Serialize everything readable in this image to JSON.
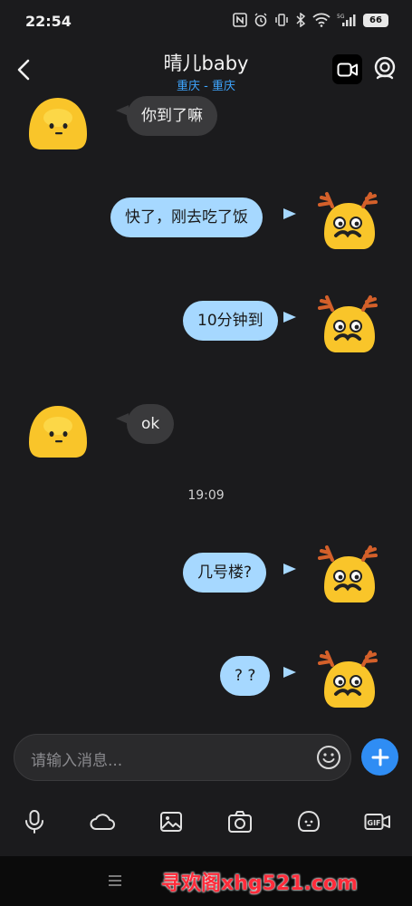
{
  "status_bar": {
    "time": "22:54",
    "network": "5G",
    "battery": "66"
  },
  "header": {
    "title": "晴儿baby",
    "subtitle": "重庆 - 重庆"
  },
  "messages": [
    {
      "direction": "incoming",
      "text": "你到了嘛"
    },
    {
      "direction": "outgoing",
      "text": "快了，刚去吃了饭"
    },
    {
      "direction": "outgoing",
      "text": "10分钟到"
    },
    {
      "direction": "incoming",
      "text": "ok"
    },
    {
      "direction": "outgoing",
      "text": "几号楼?"
    },
    {
      "direction": "outgoing",
      "text": "? ?"
    }
  ],
  "time_divider": "19:09",
  "input": {
    "placeholder": "请输入消息..."
  },
  "toolbar": [
    "mic-icon",
    "cloud-icon",
    "image-icon",
    "camera-icon",
    "sticker-icon",
    "gif-icon"
  ],
  "watermark": "寻欢阁xhg521.com",
  "colors": {
    "background": "#1b1b1d",
    "incoming_bubble": "#3a3a3c",
    "outgoing_bubble": "#a6d8ff",
    "accent": "#2f8df4",
    "subtitle": "#3ea6ff",
    "watermark": "#ff2b3a"
  }
}
